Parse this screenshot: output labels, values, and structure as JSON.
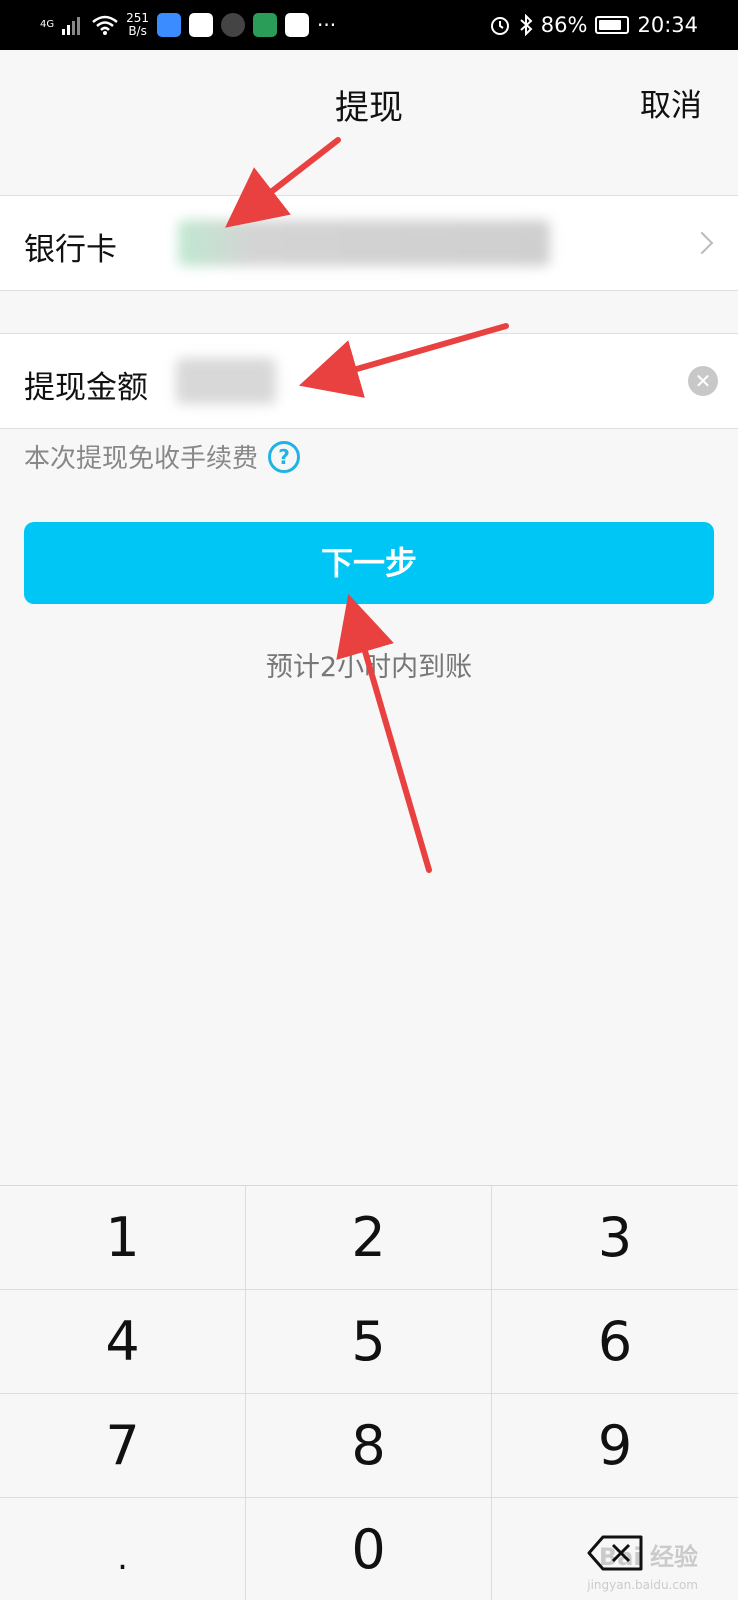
{
  "status_bar": {
    "network": "4G",
    "speed_value": "251",
    "speed_unit": "B/s",
    "more": "···",
    "battery": "86%",
    "battery_level": 0.86,
    "time": "20:34",
    "icons": [
      "signal-icon",
      "wifi-icon",
      "alarm-icon",
      "bluetooth-icon",
      "battery-icon"
    ]
  },
  "header": {
    "title": "提现",
    "cancel_label": "取消"
  },
  "bank_row": {
    "label": "银行卡"
  },
  "amount_row": {
    "label": "提现金额"
  },
  "fee_note": "本次提现免收手续费",
  "next_button": "下一步",
  "eta_text": "预计2小时内到账",
  "keypad": {
    "keys": [
      "1",
      "2",
      "3",
      "4",
      "5",
      "6",
      "7",
      "8",
      "9",
      ".",
      "0"
    ]
  },
  "watermark": {
    "text": "Bai 经验",
    "url": "jingyan.baidu.com"
  },
  "colors": {
    "accent": "#00c6f5",
    "arrow": "#e94040"
  }
}
